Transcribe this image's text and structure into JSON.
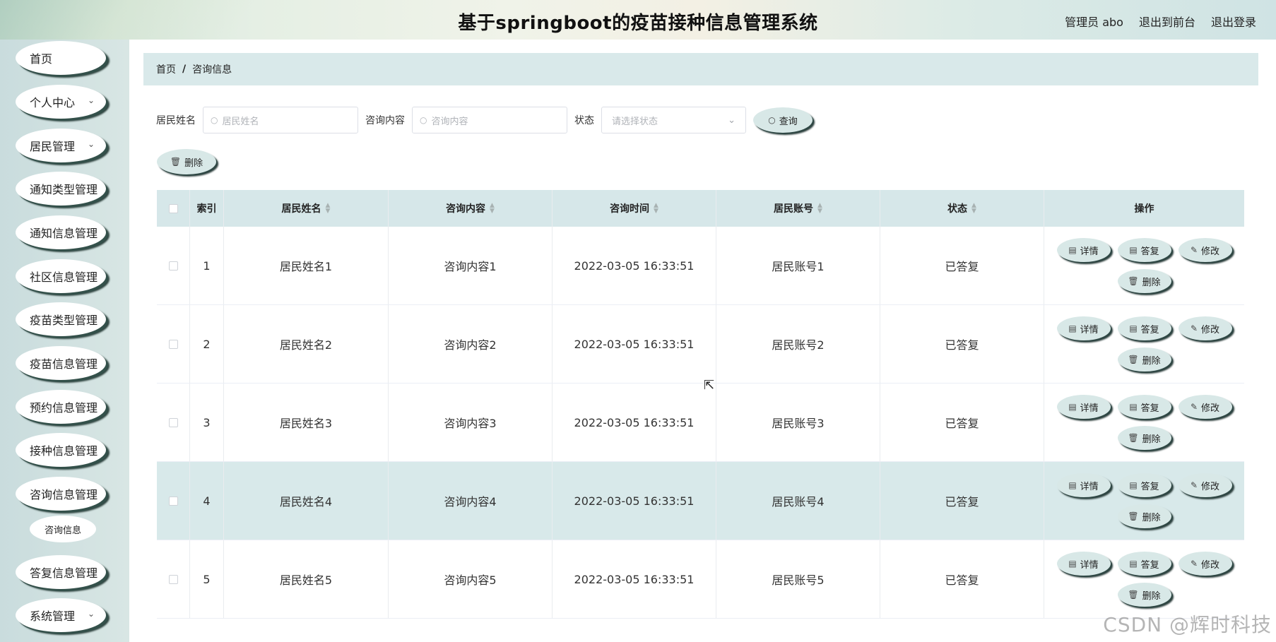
{
  "header": {
    "title": "基于springboot的疫苗接种信息管理系统",
    "user": "管理员 abo",
    "front_link": "退出到前台",
    "logout": "退出登录"
  },
  "sidebar": {
    "items": [
      {
        "label": "首页",
        "has_chevron": false
      },
      {
        "label": "个人中心",
        "has_chevron": true
      },
      {
        "label": "居民管理",
        "has_chevron": true
      },
      {
        "label": "通知类型管理",
        "has_chevron": false
      },
      {
        "label": "通知信息管理",
        "has_chevron": false
      },
      {
        "label": "社区信息管理",
        "has_chevron": false
      },
      {
        "label": "疫苗类型管理",
        "has_chevron": false
      },
      {
        "label": "疫苗信息管理",
        "has_chevron": false
      },
      {
        "label": "预约信息管理",
        "has_chevron": false
      },
      {
        "label": "接种信息管理",
        "has_chevron": false
      },
      {
        "label": "咨询信息管理",
        "has_chevron": false
      },
      {
        "label": "答复信息管理",
        "has_chevron": false
      },
      {
        "label": "系统管理",
        "has_chevron": true
      }
    ],
    "submenu_label": "咨询信息"
  },
  "breadcrumb": {
    "home": "首页",
    "separator": "/",
    "current": "咨询信息"
  },
  "search": {
    "name_label": "居民姓名",
    "name_placeholder": "居民姓名",
    "content_label": "咨询内容",
    "content_placeholder": "咨询内容",
    "status_label": "状态",
    "status_placeholder": "请选择状态",
    "query_button": "查询",
    "delete_button": "删除"
  },
  "table": {
    "columns": [
      "索引",
      "居民姓名",
      "咨询内容",
      "咨询时间",
      "居民账号",
      "状态",
      "操作"
    ],
    "rows": [
      {
        "index": "1",
        "name": "居民姓名1",
        "content": "咨询内容1",
        "time": "2022-03-05 16:33:51",
        "account": "居民账号1",
        "status": "已答复"
      },
      {
        "index": "2",
        "name": "居民姓名2",
        "content": "咨询内容2",
        "time": "2022-03-05 16:33:51",
        "account": "居民账号2",
        "status": "已答复"
      },
      {
        "index": "3",
        "name": "居民姓名3",
        "content": "咨询内容3",
        "time": "2022-03-05 16:33:51",
        "account": "居民账号3",
        "status": "已答复"
      },
      {
        "index": "4",
        "name": "居民姓名4",
        "content": "咨询内容4",
        "time": "2022-03-05 16:33:51",
        "account": "居民账号4",
        "status": "已答复"
      },
      {
        "index": "5",
        "name": "居民姓名5",
        "content": "咨询内容5",
        "time": "2022-03-05 16:33:51",
        "account": "居民账号5",
        "status": "已答复"
      }
    ],
    "actions": {
      "detail": "详情",
      "reply": "答复",
      "edit": "修改",
      "delete": "删除"
    }
  },
  "watermark": "CSDN @辉时科技"
}
